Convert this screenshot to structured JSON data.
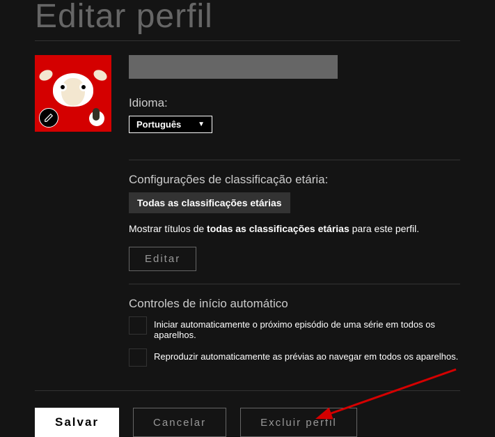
{
  "page": {
    "title": "Editar perfil"
  },
  "profile": {
    "name": ""
  },
  "language": {
    "label": "Idioma:",
    "selected": "Português"
  },
  "maturity": {
    "heading": "Configurações de classificação etária:",
    "chip": "Todas as classificações etárias",
    "desc_prefix": "Mostrar títulos de ",
    "desc_bold": "todas as classificações etárias",
    "desc_suffix": " para este perfil.",
    "edit_button": "Editar"
  },
  "autoplay": {
    "heading": "Controles de início automático",
    "options": [
      "Iniciar automaticamente o próximo episódio de uma série em todos os aparelhos.",
      "Reproduzir automaticamente as prévias ao navegar em todos os aparelhos."
    ]
  },
  "footer": {
    "save": "Salvar",
    "cancel": "Cancelar",
    "delete": "Excluir perfil"
  },
  "icons": {
    "pencil": "pencil-icon",
    "caret_down": "caret-down-icon"
  }
}
